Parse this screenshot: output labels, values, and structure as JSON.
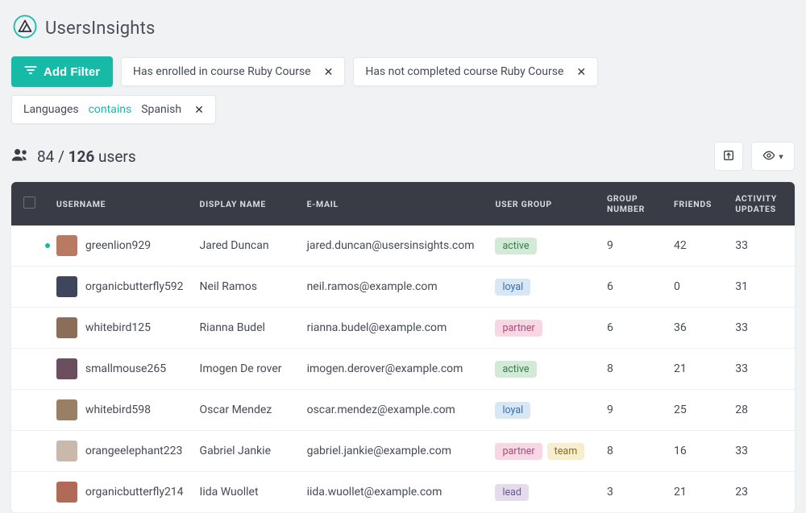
{
  "brand": {
    "name_a": "Users",
    "name_b": "Insights"
  },
  "filters": {
    "add_label": "Add Filter",
    "chips": [
      {
        "pre": "Has enrolled in course Ruby Course",
        "op": "",
        "post": ""
      },
      {
        "pre": "Has not completed course Ruby Course",
        "op": "",
        "post": ""
      },
      {
        "pre": "Languages ",
        "op": "contains",
        "post": " Spanish"
      }
    ]
  },
  "summary": {
    "shown": "84",
    "sep": " / ",
    "total": "126",
    "suffix": " users"
  },
  "columns": {
    "username": "Username",
    "display_name": "Display Name",
    "email": "E-mail",
    "user_group": "User Group",
    "group_number": "Group Number",
    "friends": "Friends",
    "activity_updates": "Activity Updates"
  },
  "rows": [
    {
      "online": true,
      "avatar": "#b97a63",
      "username": "greenlion929",
      "display_name": "Jared Duncan",
      "email": "jared.duncan@usersinsights.com",
      "tags": [
        "active"
      ],
      "group_number": "9",
      "friends": "42",
      "activity": "33"
    },
    {
      "online": false,
      "avatar": "#3f455a",
      "username": "organicbutterfly592",
      "display_name": "Neil Ramos",
      "email": "neil.ramos@example.com",
      "tags": [
        "loyal"
      ],
      "group_number": "6",
      "friends": "0",
      "activity": "31"
    },
    {
      "online": false,
      "avatar": "#8a6e5a",
      "username": "whitebird125",
      "display_name": "Rianna Budel",
      "email": "rianna.budel@example.com",
      "tags": [
        "partner"
      ],
      "group_number": "6",
      "friends": "36",
      "activity": "33"
    },
    {
      "online": false,
      "avatar": "#6b4f60",
      "username": "smallmouse265",
      "display_name": "Imogen De rover",
      "email": "imogen.derover@example.com",
      "tags": [
        "active"
      ],
      "group_number": "8",
      "friends": "21",
      "activity": "33"
    },
    {
      "online": false,
      "avatar": "#997f66",
      "username": "whitebird598",
      "display_name": "Oscar Mendez",
      "email": "oscar.mendez@example.com",
      "tags": [
        "loyal"
      ],
      "group_number": "9",
      "friends": "25",
      "activity": "28"
    },
    {
      "online": false,
      "avatar": "#c8b9aa",
      "username": "orangeelephant223",
      "display_name": "Gabriel Jankie",
      "email": "gabriel.jankie@example.com",
      "tags": [
        "partner",
        "team"
      ],
      "group_number": "8",
      "friends": "16",
      "activity": "33"
    },
    {
      "online": false,
      "avatar": "#b06a55",
      "username": "organicbutterfly214",
      "display_name": "Iida Wuollet",
      "email": "iida.wuollet@example.com",
      "tags": [
        "lead"
      ],
      "group_number": "3",
      "friends": "21",
      "activity": "23"
    }
  ]
}
